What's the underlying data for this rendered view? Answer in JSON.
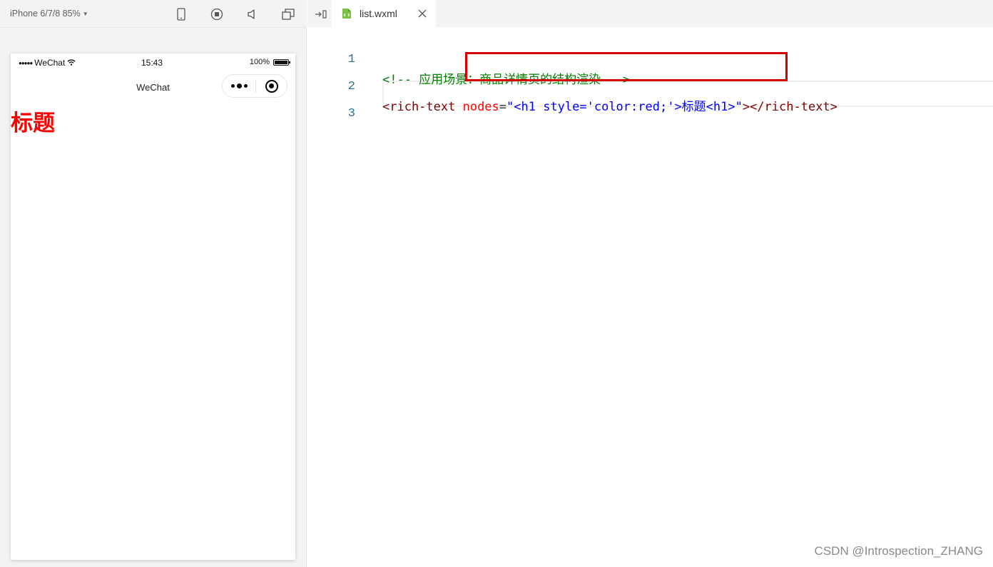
{
  "simulator": {
    "device_label": "iPhone 6/7/8 85%",
    "toolbar_icons": [
      "phone-icon",
      "record-icon",
      "volume-icon",
      "window-icon"
    ],
    "status_bar": {
      "signal": "●●●●●",
      "carrier": "WeChat",
      "time": "15:43",
      "battery_text": "100%",
      "battery_level": 1.0
    },
    "nav_title": "WeChat",
    "page_heading": "标题",
    "heading_color": "#ff0000"
  },
  "editor": {
    "tab": {
      "filename": "list.wxml"
    },
    "lines": [
      {
        "number": "1",
        "comment": "<!-- 应用场景：商品详情页的结构渲染 -->"
      },
      {
        "number": "2",
        "tag_open": "<rich-text ",
        "attr_name": "nodes",
        "equals": "=",
        "attr_value": "\"<h1 style='color:red;'>标题<h1>\"",
        "tag_close": "></rich-text>"
      },
      {
        "number": "3"
      }
    ]
  },
  "colors": {
    "comment": "#008000",
    "tag": "#800000",
    "attribute": "#ff0000",
    "value": "#0000ff",
    "line_number": "#237893",
    "highlight_border": "#d40000"
  },
  "watermark": "CSDN @Introspection_ZHANG"
}
